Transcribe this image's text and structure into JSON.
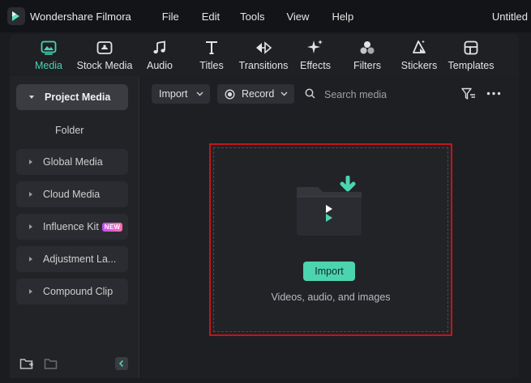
{
  "app": {
    "name": "Wondershare Filmora",
    "doc_title": "Untitled"
  },
  "menu": {
    "items": [
      "File",
      "Edit",
      "Tools",
      "View",
      "Help"
    ]
  },
  "toolbar": {
    "tools": [
      {
        "label": "Media",
        "icon": "media-icon",
        "active": true
      },
      {
        "label": "Stock Media",
        "icon": "stock-media-icon"
      },
      {
        "label": "Audio",
        "icon": "music-note-icon"
      },
      {
        "label": "Titles",
        "icon": "text-t-icon"
      },
      {
        "label": "Transitions",
        "icon": "transitions-icon"
      },
      {
        "label": "Effects",
        "icon": "effects-sparkle-icon"
      },
      {
        "label": "Filters",
        "icon": "filters-icon"
      },
      {
        "label": "Stickers",
        "icon": "stickers-icon"
      },
      {
        "label": "Templates",
        "icon": "templates-icon"
      }
    ]
  },
  "sidebar": {
    "items": [
      {
        "label": "Project Media",
        "active": true
      },
      {
        "label": "Folder"
      },
      {
        "label": "Global Media"
      },
      {
        "label": "Cloud Media"
      },
      {
        "label": "Influence Kit",
        "badge": "NEW"
      },
      {
        "label": "Adjustment La..."
      },
      {
        "label": "Compound Clip"
      }
    ]
  },
  "media_toolbar": {
    "import_label": "Import",
    "record_label": "Record",
    "search_placeholder": "Search media"
  },
  "dropzone": {
    "button_label": "Import",
    "hint": "Videos, audio, and images"
  },
  "colors": {
    "accent": "#4cd4b1",
    "highlight_border": "#c4141c",
    "badge_gradient": [
      "#c14cf5",
      "#ff6fa8"
    ]
  }
}
